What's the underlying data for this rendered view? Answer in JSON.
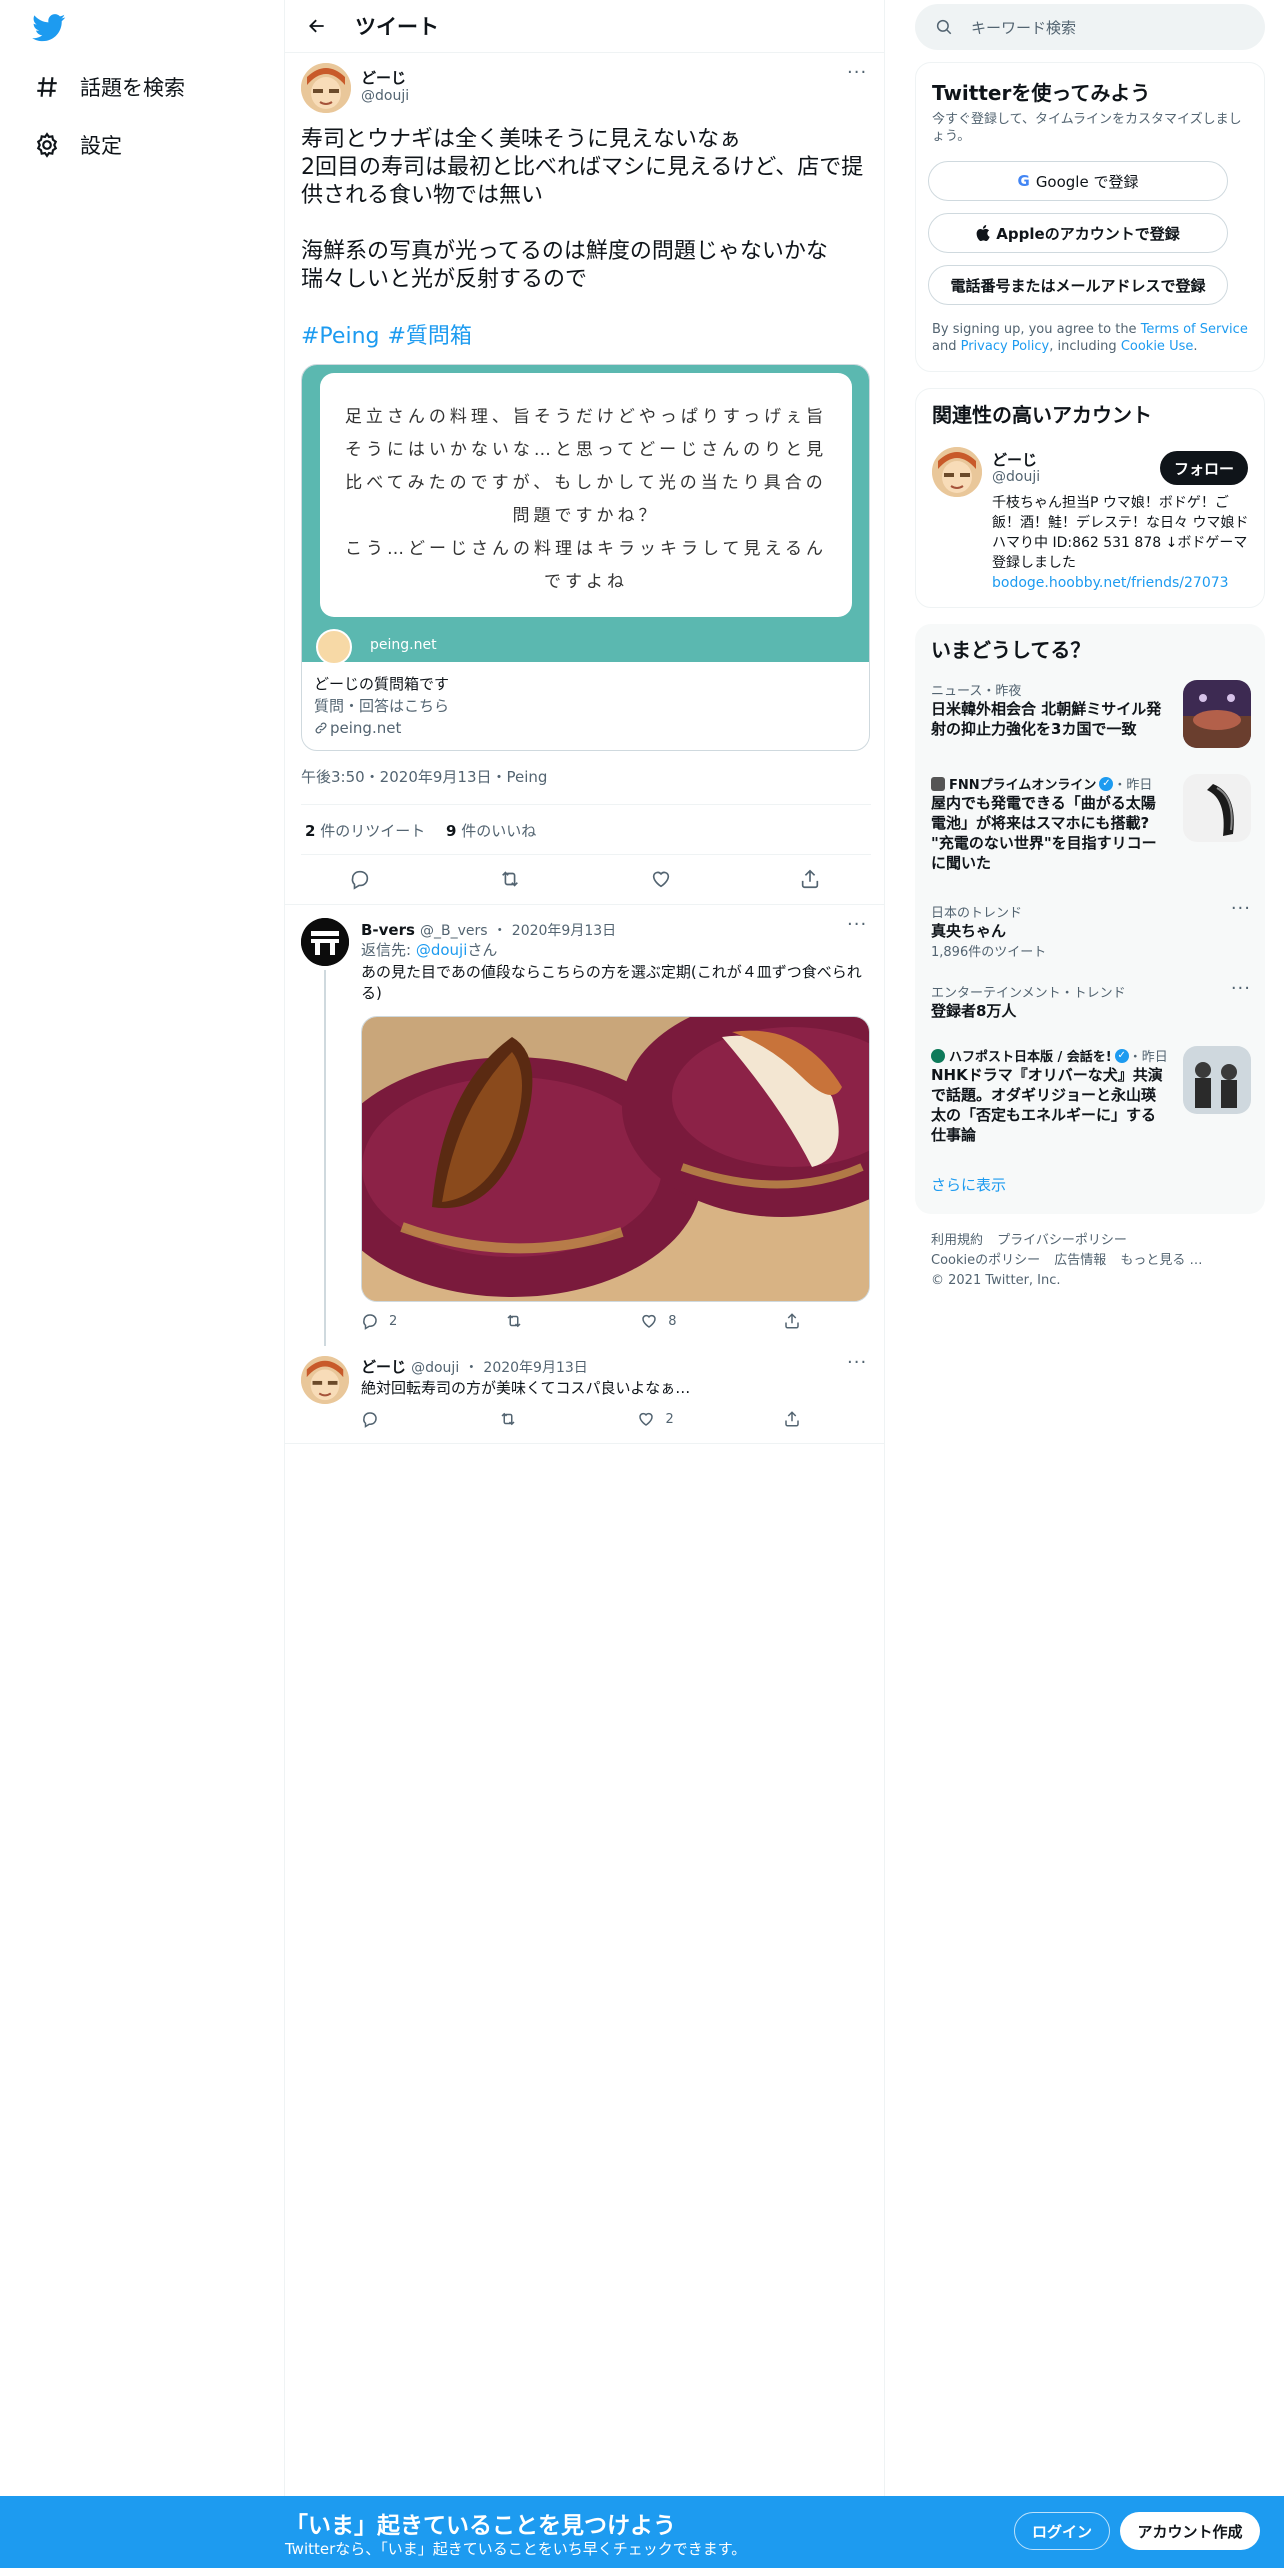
{
  "nav": {
    "explore_label": "話題を検索",
    "settings_label": "設定"
  },
  "header": {
    "title": "ツイート"
  },
  "tweet": {
    "name": "どーじ",
    "handle": "@douji",
    "text": "寿司とウナギは全く美味そうに見えないなぁ\n2回目の寿司は最初と比べればマシに見えるけど、店で提供される食い物では無い\n\n海鮮系の写真が光ってるのは鮮度の問題じゃないかな\n瑞々しいと光が反射するので",
    "hashtags": [
      "#Peing",
      "#質問箱"
    ],
    "card": {
      "image_text": "足立さんの料理、旨そうだけどやっぱりすっげぇ旨そうにはいかないな…と思ってどーじさんのりと見比べてみたのですが、もしかして光の当たり具合の問題ですかね？\nこう…どーじさんの料理はキラッキラして見えるんですよね",
      "image_site": "peing.net",
      "title": "どーじの質問箱です",
      "description": "質問・回答はこちら",
      "domain": "peing.net"
    },
    "timestamp": "午後3:50・2020年9月13日・Peing",
    "retweets_count": "2",
    "retweets_label": " 件のリツイート",
    "likes_count": "9",
    "likes_label": " 件のいいね"
  },
  "replies": [
    {
      "name": "B-vers",
      "handle": "@_B_vers",
      "date": "2020年9月13日",
      "reply_to_prefix": "返信先: ",
      "reply_to_handle": "@douji",
      "reply_to_suffix": "さん",
      "text": "あの見た目であの値段ならこちらの方を選ぶ定期(これが４皿ずつ食べられる)",
      "reply_count": "2",
      "retweet_count": "",
      "like_count": "8"
    },
    {
      "name": "どーじ",
      "handle": "@douji",
      "date": "2020年9月13日",
      "text": "絶対回転寿司の方が美味くてコスパ良いよなぁ…",
      "reply_count": "",
      "retweet_count": "",
      "like_count": "2"
    }
  ],
  "sidebar": {
    "search_placeholder": "キーワード検索",
    "signup": {
      "title": "Twitterを使ってみよう",
      "subtitle": "今すぐ登録して、タイムラインをカスタマイズしましょう。",
      "google_label": "Google で登録",
      "apple_label": "Appleのアカウントで登録",
      "phone_label": "電話番号またはメールアドレスで登録",
      "legal_prefix": "By signing up, you agree to the ",
      "terms": "Terms of Service",
      "and": " and ",
      "privacy": "Privacy Policy",
      "including": ", including ",
      "cookie": "Cookie Use",
      "period": "."
    },
    "related": {
      "title": "関連性の高いアカウント",
      "name": "どーじ",
      "handle": "@douji",
      "follow_label": "フォロー",
      "bio": "千枝ちゃん担当P ウマ娘！ボドゲ！ご飯！酒！鮭！デレステ！な日々 ウマ娘ドハマり中 ID:862 531 878 ↓ボドゲーマ登録しました",
      "link": "bodoge.hoobby.net/friends/27073"
    },
    "trends": {
      "title": "いまどうしてる？",
      "items": [
        {
          "category": "ニュース・昨夜",
          "text": "日米韓外相会合 北朝鮮ミサイル発射の抑止力強化を3カ国で一致",
          "count": ""
        },
        {
          "category": "FNNプライムオンライン",
          "category_suffix": "・昨日",
          "text": "屋内でも発電できる「曲がる太陽電池」が将来はスマホにも搭載? \"充電のない世界\"を目指すリコーに聞いた",
          "count": ""
        },
        {
          "category": "日本のトレンド",
          "text": "真央ちゃん",
          "count": "1,896件のツイート"
        },
        {
          "category": "エンターテインメント・トレンド",
          "text": "登録者8万人",
          "count": ""
        },
        {
          "category": "ハフポスト日本版 / 会話を!",
          "category_suffix": "・昨日",
          "text": "NHKドラマ『オリバーな犬』共演で話題。オダギリジョーと永山瑛太の「否定もエネルギーに」する仕事論",
          "count": ""
        }
      ],
      "show_more": "さらに表示"
    },
    "footer": {
      "links": [
        "利用規約",
        "プライバシーポリシー",
        "Cookieのポリシー",
        "広告情報",
        "もっと見る …"
      ],
      "copyright": "© 2021 Twitter, Inc."
    }
  },
  "bottom_bar": {
    "title": "「いま」起きていることを見つけよう",
    "subtitle": "Twitterなら、「いま」起きていることをいち早くチェックできます。",
    "login_label": "ログイン",
    "signup_label": "アカウント作成"
  },
  "colors": {
    "accent": "#1d9bf0",
    "text": "#0f1419",
    "secondary": "#536471",
    "card_teal": "#5bb8b0"
  }
}
